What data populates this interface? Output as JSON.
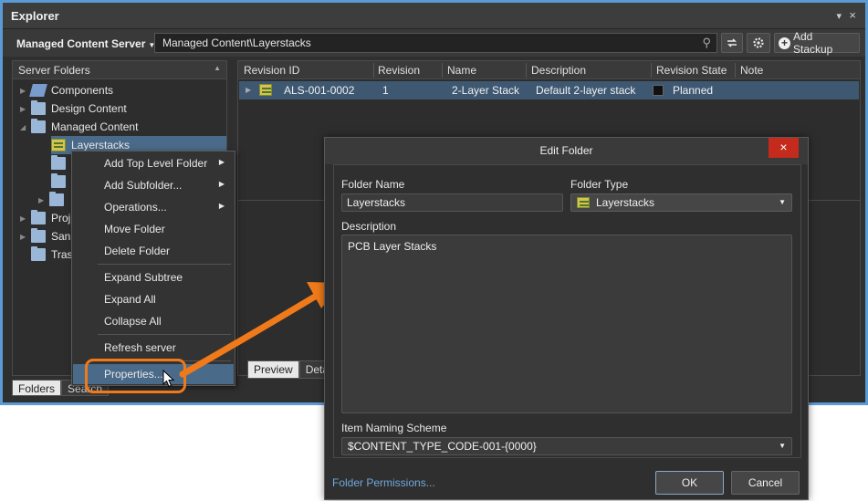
{
  "explorer": {
    "title": "Explorer",
    "pin_glyph": "▾",
    "close_glyph": "×",
    "server_label": "Managed Content Server",
    "path": "Managed Content\\Layerstacks",
    "add_stackup_label": "Add Stackup"
  },
  "left_panel": {
    "header": "Server Folders",
    "items": [
      {
        "label": "Components",
        "icon": "components-icon"
      },
      {
        "label": "Design Content",
        "icon": "folder-icon"
      },
      {
        "label": "Managed Content",
        "icon": "folder-icon"
      },
      {
        "label": "Layerstacks",
        "icon": "layerstack-icon"
      },
      {
        "label": "Proj",
        "icon": "project-folder-icon"
      },
      {
        "label": "San",
        "icon": "folder-icon"
      },
      {
        "label": "Tras",
        "icon": "folder-icon"
      }
    ],
    "tabs": {
      "folders": "Folders",
      "search": "Search"
    }
  },
  "grid": {
    "columns": [
      "Revision ID",
      "Revision",
      "Name",
      "Description",
      "Revision State",
      "Note"
    ],
    "rows": [
      {
        "revision_id": "ALS-001-0002",
        "revision": "1",
        "name": "2-Layer Stack",
        "description": "Default 2-layer stack",
        "state": "Planned"
      }
    ],
    "lower_tabs": {
      "preview": "Preview",
      "details": "Detail"
    }
  },
  "context_menu": {
    "items": [
      "Add Top Level Folder",
      "Add Subfolder...",
      "Operations...",
      "Move Folder",
      "Delete Folder",
      "Expand Subtree",
      "Expand All",
      "Collapse All",
      "Refresh server",
      "Properties..."
    ]
  },
  "dialog": {
    "title": "Edit Folder",
    "folder_name_label": "Folder Name",
    "folder_name_value": "Layerstacks",
    "folder_type_label": "Folder Type",
    "folder_type_value": "Layerstacks",
    "description_label": "Description",
    "description_value": "PCB Layer Stacks",
    "naming_scheme_label": "Item Naming Scheme",
    "naming_scheme_value": "$CONTENT_TYPE_CODE-001-{0000}",
    "folder_permissions_link": "Folder Permissions...",
    "ok_label": "OK",
    "cancel_label": "Cancel"
  },
  "colors": {
    "accent_orange": "#f07a1a",
    "selection_blue": "#4a6a8a",
    "close_red": "#c42b1c",
    "window_border": "#5a9bd5"
  }
}
